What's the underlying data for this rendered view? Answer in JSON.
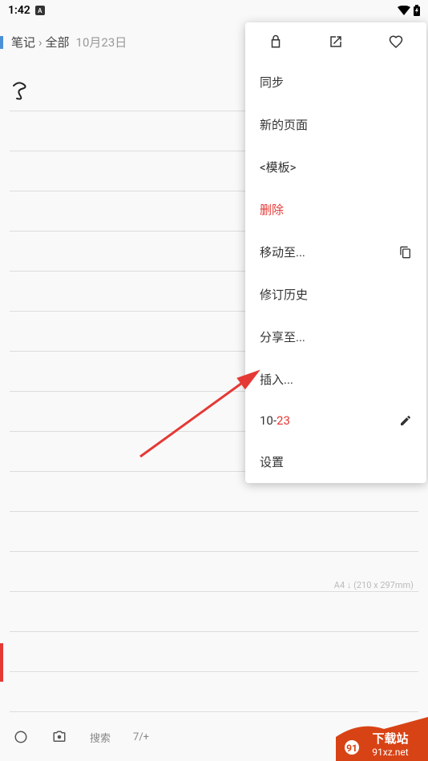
{
  "status_bar": {
    "time": "1:42",
    "badge": "A"
  },
  "breadcrumb": {
    "root": "笔记",
    "category": "全部",
    "date": "10月23日"
  },
  "note": {
    "content": "↺ɜ",
    "paper_info": "A4 ↓ (210 x 297mm)"
  },
  "menu": {
    "sync": "同步",
    "new_page": "新的页面",
    "template": "<模板>",
    "delete": "删除",
    "move_to": "移动至...",
    "revision": "修订历史",
    "share": "分享至...",
    "insert": "插入...",
    "date_prefix": "10-",
    "date_suffix": "23",
    "settings": "设置"
  },
  "bottom": {
    "search": "搜索",
    "page": "7/+"
  },
  "watermark": {
    "line1": "下载站",
    "line2": "91xz.net"
  }
}
